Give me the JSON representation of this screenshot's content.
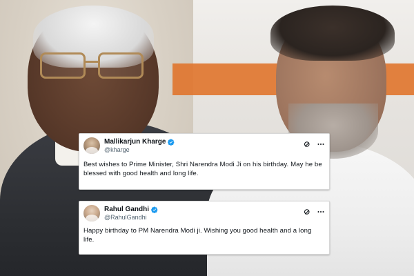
{
  "tweets": [
    {
      "name": "Mallikarjun Kharge",
      "handle": "@kharge",
      "text": "Best wishes to Prime Minister, Shri Narendra Modi Ji on his birthday. May he be blessed with good health and long life.",
      "avatar_icon": "avatar-photo",
      "verified_icon": "verified-badge-icon",
      "actions": [
        "grok-icon",
        "more-icon"
      ]
    },
    {
      "name": "Rahul Gandhi",
      "handle": "@RahulGandhi",
      "text": "Happy birthday to PM Narendra Modi ji. Wishing you good health and a long life.",
      "avatar_icon": "avatar-photo",
      "verified_icon": "verified-badge-icon",
      "actions": [
        "grok-icon",
        "more-icon"
      ]
    }
  ],
  "colors": {
    "verified_blue": "#1d9bf0",
    "text_primary": "#0f1419",
    "text_secondary": "#536471"
  }
}
